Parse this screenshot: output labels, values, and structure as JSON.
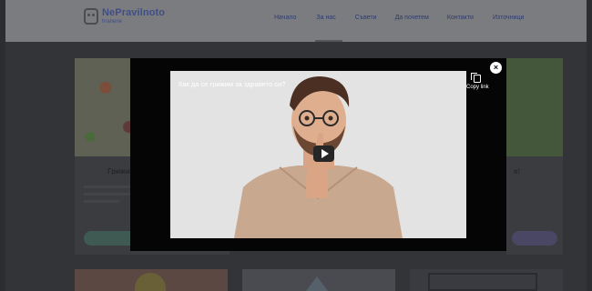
{
  "header": {
    "logo_title": "NePravilnoto",
    "logo_subtitle": "hranene",
    "nav": [
      "Начало",
      "За нас",
      "Съвети",
      "Да почетем",
      "Контакти",
      "Източници"
    ]
  },
  "cards": {
    "card1_title": "Грижи",
    "card3_title": "e!"
  },
  "modal": {
    "video_title": "Как да се грижим за здравето си?",
    "copy_link_label": "Copy link",
    "close_symbol": "×"
  },
  "icons": {
    "logo": "logo-mark-icon",
    "avatar": "channel-avatar-icon",
    "copy": "copy-icon",
    "play": "play-icon",
    "close": "close-icon"
  }
}
